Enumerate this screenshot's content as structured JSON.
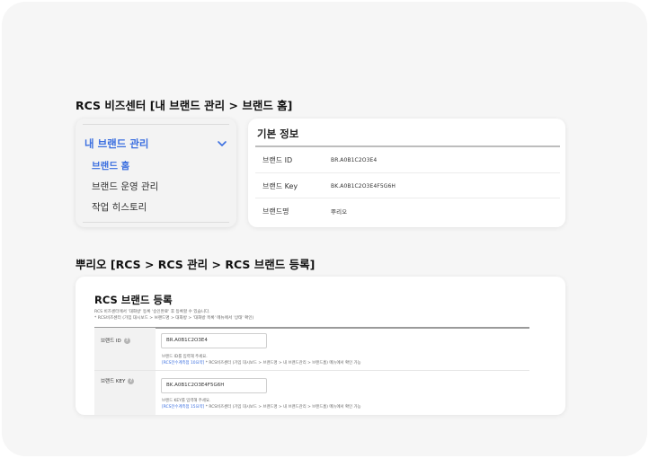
{
  "section1_title": "RCS 비즈센터 [내 브랜드 관리 > 브랜드 홈]",
  "section2_title": "뿌리오 [RCS > RCS 관리 > RCS 브랜드 등록]",
  "sidebar": {
    "group_label": "내 브랜드 관리",
    "items": [
      {
        "label": "브랜드 홈",
        "active": true
      },
      {
        "label": "브랜드 운영 관리",
        "active": false
      },
      {
        "label": "작업 히스토리",
        "active": false
      }
    ]
  },
  "basic_info": {
    "title": "기본 정보",
    "rows": [
      {
        "label": "브랜드 ID",
        "value": "BR.A0B1C2O3E4"
      },
      {
        "label": "브랜드 Key",
        "value": "BK.A0B1C2O3E4F5G6H"
      },
      {
        "label": "브랜드명",
        "value": "뿌리오"
      }
    ]
  },
  "register": {
    "title": "RCS 브랜드 등록",
    "note1": "RCS 비즈센터에서 '대화방' 등록 '승인완료' 후 등록할 수 있습니다.",
    "note2": "* RCS비즈센터 (가입 대시보드 > 브랜드명 > 대화방 > '대화방 목록' 메뉴에서 '상태' 확인)",
    "fields": [
      {
        "label": "브랜드 ID",
        "value": "BR.A0B1C2O3E4",
        "help1": "브랜드 ID를 입력해 주세요.",
        "help_link": "[RCS전수계측점 10요약]",
        "help_rest": " * RCS비즈센터 (가입 대시보드 > 브랜드명 > 내 브랜드관리 > 브랜드홈) 메뉴에서 확인 가능"
      },
      {
        "label": "브랜드 KEY",
        "value": "BK.A0B1C2O3E4F5G6H",
        "help1": "브랜드 KEY를 입력해 주세요.",
        "help_link": "[RCS전수계측점 15요약]",
        "help_rest": " * RCS비즈센터 (가입 대시보드 > 브랜드명 > 내 브랜드관리 > 브랜드홈) 메뉴에서 확인 가능"
      }
    ]
  },
  "colors": {
    "accent": "#3b6fe0",
    "frame_bg": "#f6f6f6"
  },
  "icons": {
    "sidebar_toggle": "chevron-down-icon",
    "help": "help-circle-icon"
  }
}
